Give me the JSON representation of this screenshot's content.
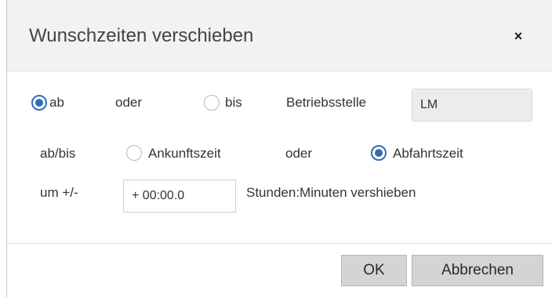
{
  "dialog": {
    "title": "Wunschzeiten verschieben",
    "close_label": "×"
  },
  "row1": {
    "radio_ab_label": "ab",
    "oder_label": "oder",
    "radio_bis_label": "bis",
    "betriebsstelle_label": "Betriebsstelle",
    "betriebsstelle_value": "LM",
    "selected": "ab"
  },
  "row2": {
    "abbis_label": "ab/bis",
    "ankunft_label": "Ankunftszeit",
    "oder_label": "oder",
    "abfahrt_label": "Abfahrtszeit",
    "selected": "Abfahrtszeit"
  },
  "row3": {
    "um_label": "um +/-",
    "offset_value": "+ 00:00.0",
    "hint_label": "Stunden:Minuten vershieben"
  },
  "footer": {
    "ok_label": "OK",
    "cancel_label": "Abbrechen"
  },
  "colors": {
    "accent": "#2f6db5",
    "header_bg": "#f2f2f2",
    "button_bg": "#d4d4d4"
  }
}
